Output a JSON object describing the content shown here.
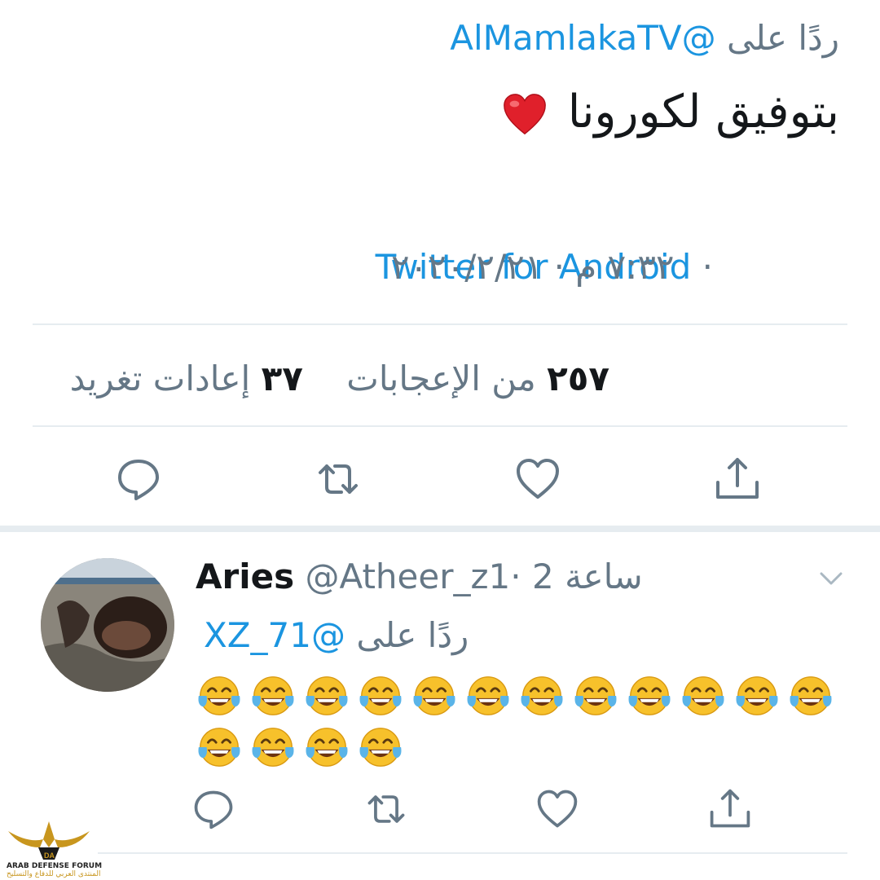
{
  "tweet": {
    "reply_prefix": "ردًا على",
    "reply_handle": "@AlMamlakaTV",
    "text": "بتوفيق لكورونا",
    "time_and_date": "٧:٣٢ م · ٢٠٢٠/٢/٢١",
    "separator": "·",
    "source": "Twitter for Android",
    "likes_count": "٢٥٧",
    "likes_label": "من الإعجابات",
    "retweets_count": "٣٧",
    "retweets_label": "إعادات تغريد"
  },
  "reply": {
    "name": "Aries",
    "handle": "@Atheer_z1",
    "separator": "·",
    "time": "2 ساعة",
    "reply_prefix": "ردًا على",
    "reply_handle": "@XZ_71",
    "emoji_count_row1": 12,
    "emoji_count_row2": 4
  },
  "icons": [
    "reply-icon",
    "retweet-icon",
    "like-icon",
    "share-icon",
    "chevron-down-icon",
    "red-heart-emoji",
    "tears-of-joy-emoji"
  ],
  "watermark": {
    "line1": "ARAB DEFENSE FORUM",
    "line2": "المنتدى العربي للدفاع والتسليح"
  },
  "colors": {
    "link": "#1b95e0",
    "secondary_text": "#657786",
    "divider": "#e6ecf0"
  }
}
